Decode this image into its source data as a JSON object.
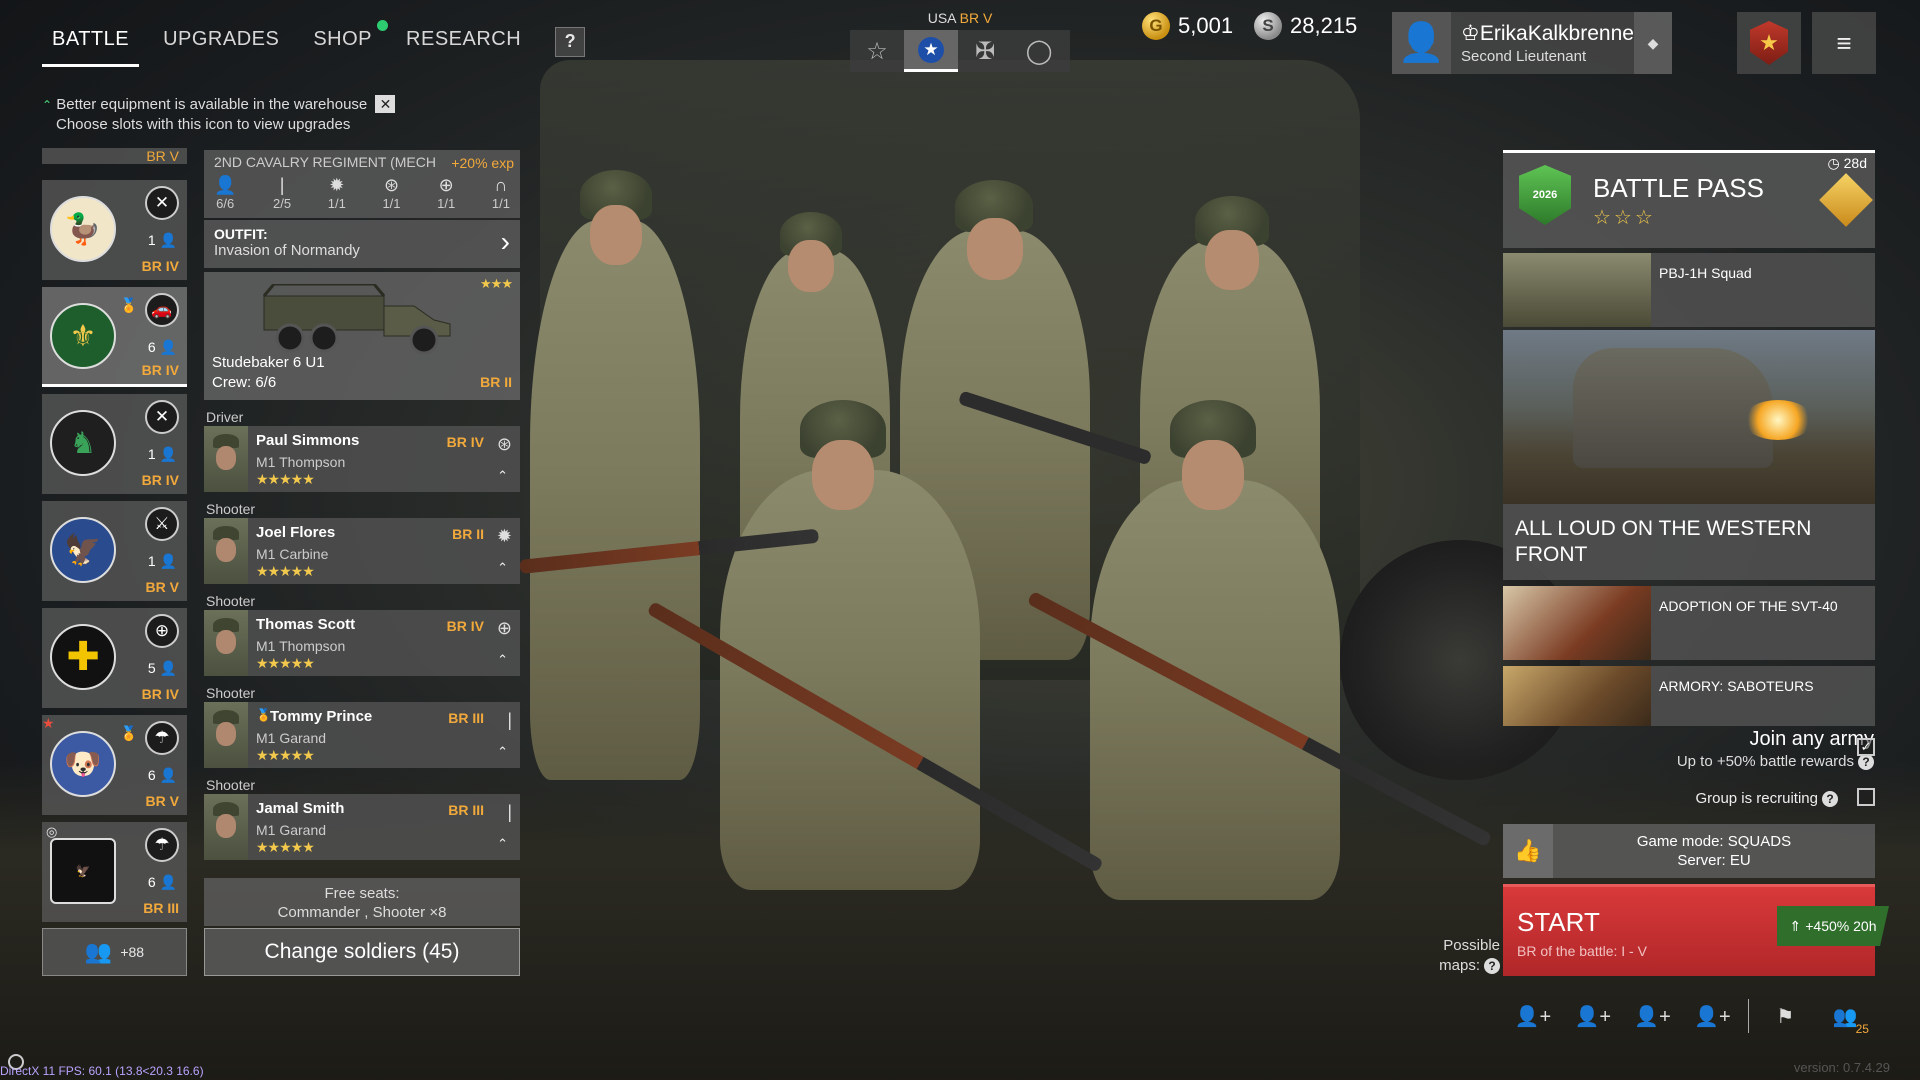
{
  "nav": {
    "tabs": [
      "BATTLE",
      "UPGRADES",
      "SHOP",
      "RESEARCH"
    ],
    "help_label": "?"
  },
  "notice": {
    "line1": "Better equipment is available in the warehouse",
    "line2": "Choose slots with this icon to view upgrades",
    "close_label": "✕"
  },
  "country": {
    "name": "USA",
    "br": "BR V"
  },
  "currency": {
    "gold": "5,001",
    "silver": "28,215"
  },
  "profile": {
    "name": "ErikaKalkbrenne",
    "rank": "Second Lieutenant"
  },
  "squads": [
    {
      "br": "BR IV",
      "count": "1",
      "emblem": "duck-emblem",
      "icon": "crossed-tools-icon"
    },
    {
      "br": "BR IV",
      "count": "6",
      "emblem": "engineer-emblem",
      "icon": "car-icon",
      "selected": true
    },
    {
      "br": "BR IV",
      "count": "1",
      "emblem": "knight-emblem",
      "icon": "crossed-tools-icon"
    },
    {
      "br": "BR V",
      "count": "1",
      "emblem": "eagle-emblem",
      "icon": "sniper-icon"
    },
    {
      "br": "BR IV",
      "count": "5",
      "emblem": "cross-emblem",
      "icon": "medic-icon"
    },
    {
      "br": "BR V",
      "count": "6",
      "emblem": "bulldog-emblem",
      "icon": "parachute-icon"
    },
    {
      "br": "BR III",
      "count": "6",
      "emblem": "airborne-emblem",
      "icon": "parachute-icon"
    }
  ],
  "squad_top_br": "BR V",
  "squad_footer": "+88",
  "regiment": {
    "name": "2ND CAVALRY REGIMENT (MECH",
    "exp": "+20% exp",
    "stats": [
      {
        "icon": "person-icon",
        "value": "6/6"
      },
      {
        "icon": "rifle-icon",
        "value": "2/5"
      },
      {
        "icon": "flame-icon",
        "value": "1/1"
      },
      {
        "icon": "wheel-icon",
        "value": "1/1"
      },
      {
        "icon": "medic-icon",
        "value": "1/1"
      },
      {
        "icon": "radio-icon",
        "value": "1/1"
      }
    ]
  },
  "outfit": {
    "label": "OUTFIT:",
    "value": "Invasion of Normandy"
  },
  "vehicle": {
    "name": "Studebaker 6 U1",
    "crew": "Crew: 6/6",
    "br": "BR II",
    "stars": "★★★"
  },
  "soldiers": [
    {
      "role": "Driver",
      "name": "Paul Simmons",
      "weapon": "M1 Thompson",
      "br": "BR IV",
      "icon": "⊛",
      "stars": "★★★★★"
    },
    {
      "role": "Shooter",
      "name": "Joel Flores",
      "weapon": "M1 Carbine",
      "br": "BR II",
      "icon": "✹",
      "stars": "★★★★★"
    },
    {
      "role": "Shooter",
      "name": "Thomas Scott",
      "weapon": "M1 Thompson",
      "br": "BR IV",
      "icon": "⊕",
      "stars": "★★★★★"
    },
    {
      "role": "Shooter",
      "name": "Tommy Prince",
      "weapon": "M1 Garand",
      "br": "BR III",
      "icon": "|",
      "stars": "★★★★★"
    },
    {
      "role": "Shooter",
      "name": "Jamal Smith",
      "weapon": "M1 Garand",
      "br": "BR III",
      "icon": "|",
      "stars": "★★★★★"
    }
  ],
  "free_seats": {
    "line1": "Free seats:",
    "line2": "Commander , Shooter ×8"
  },
  "change_soldiers": "Change soldiers (45)",
  "battle_pass": {
    "title": "BATTLE PASS",
    "days": "28d",
    "year": "2026",
    "stars": "☆☆☆"
  },
  "news": [
    {
      "title": "PBJ-1H Squad"
    },
    {
      "title": "ALL LOUD ON THE WESTERN FRONT"
    },
    {
      "title": "ADOPTION OF THE SVT-40"
    },
    {
      "title": "ARMORY: SABOTEURS"
    }
  ],
  "join": {
    "title": "Join any army",
    "subtitle": "Up to +50% battle rewards",
    "recruiting": "Group is recruiting"
  },
  "mode": {
    "game_mode": "Game mode: SQUADS",
    "server": "Server: EU"
  },
  "start": {
    "label": "START",
    "br_range": "BR of the battle: I - V",
    "xp_bonus": "+450% 20h"
  },
  "possible_maps": {
    "line1": "Possible",
    "line2": "maps:"
  },
  "party_count": "25",
  "fps": "DirectX 11 FPS: 60.1 (13.8<20.3 16.6)",
  "version": "version: 0.7.4.29",
  "colors": {
    "accent": "#f2a93b",
    "start": "#c6302f",
    "shop_dot": "#2ecc71",
    "bp_green": "#4caf50"
  }
}
